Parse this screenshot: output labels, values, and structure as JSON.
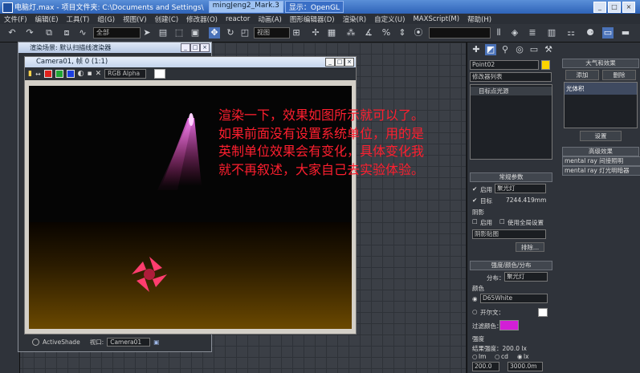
{
  "app_title": "电脑灯.max - 项目文件夹: C:\\Documents and Settings\\",
  "title_tabs": [
    "mingJeng2_Mark.3",
    "显示：OpenGL"
  ],
  "menus": [
    "文件(F)",
    "编辑(E)",
    "工具(T)",
    "组(G)",
    "视图(V)",
    "创建(C)",
    "修改器(O)",
    "reactor",
    "动画(A)",
    "图形编辑器(D)",
    "渲染(R)",
    "自定义(U)",
    "MAXScript(M)",
    "帮助(H)"
  ],
  "toolbar": {
    "select_filter": "全部",
    "ref_coord": "视图"
  },
  "back_window": {
    "title": "渲染场景: 默认扫描线渲染器"
  },
  "frame_window": {
    "title": "Camera01, 帧 0 (1:1)",
    "channel": "RGB Alpha"
  },
  "overlay_text": [
    "渲染一下，效果如图所示就可以了。",
    "如果前面没有设置系统单位，用的是",
    "英制单位效果会有变化，具体变化我",
    "就不再叙述，大家自己去实验体验。"
  ],
  "bottom_bar": {
    "mode": "ActiveShade",
    "view_label": "视口:",
    "view_value": "Camera01"
  },
  "panel": {
    "object_name": "Point02",
    "modifier_list": "修改器列表",
    "stack_item": "目标点光源",
    "env": {
      "header": "大气和效果",
      "add": "添加",
      "delete": "删除",
      "item": "光体积",
      "setup": "设置"
    },
    "advanced": "高级效果",
    "mr1": "mental ray 间接照明",
    "mr2": "mental ray 灯光明暗器",
    "general_params": "常规参数",
    "on_label": "启用",
    "type_value": "聚光灯",
    "targeted": "目标",
    "target_distance": "7244.419mm",
    "shadows": "阴影",
    "shadows_on": "启用",
    "use_global": "使用全局设置",
    "shadow_type": "阴影贴图",
    "exclude": "排除...",
    "intensity_rollout": "强度/颜色/分布",
    "distribution_label": "分布：",
    "distribution_value": "聚光灯",
    "color_label": "颜色",
    "color_preset": "D65White",
    "kelvin_label": "开尔文：",
    "filter_label": "过滤颜色：",
    "filter_color": "#d21fd6",
    "strength_label": "强度",
    "result_strength": "结果强度：200.0 lx",
    "units": [
      "lm",
      "cd",
      "lx"
    ],
    "value1": "200.0",
    "value2": "3000.0m"
  }
}
